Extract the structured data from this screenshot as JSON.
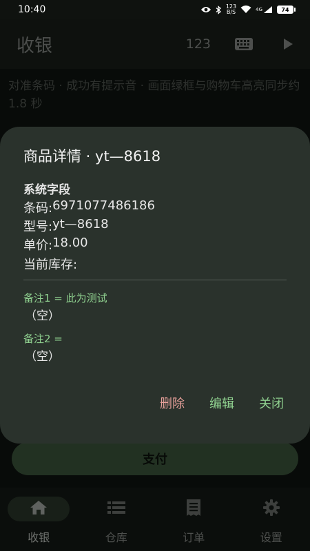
{
  "status_bar": {
    "time": "10:40",
    "speed_value": "123",
    "speed_unit": "B/S",
    "signal": "4G",
    "battery": "74"
  },
  "app_bar": {
    "title": "收银",
    "scan_count": "123"
  },
  "hint": "对准条码 · 成功有提示音 · 画面绿框与购物车高亮同步约 1.8 秒",
  "pay_button": {
    "label": "支付"
  },
  "dialog": {
    "title": "商品详情 · yt—8618",
    "section_title": "系统字段",
    "fields": [
      {
        "label": "条码:",
        "value": "6971077486186"
      },
      {
        "label": "型号:",
        "value": "yt—8618"
      },
      {
        "label": "单价:",
        "value": "18.00"
      },
      {
        "label": "当前库存:",
        "value": ""
      }
    ],
    "notes": [
      {
        "label": "备注1 = 此为测试",
        "value": "（空）"
      },
      {
        "label": "备注2 =",
        "value": "（空）"
      }
    ],
    "actions": {
      "delete": "删除",
      "edit": "编辑",
      "close": "关闭"
    }
  },
  "bottom_nav": {
    "items": [
      {
        "label": "收银",
        "icon": "home-icon",
        "active": true
      },
      {
        "label": "仓库",
        "icon": "list-icon",
        "active": false
      },
      {
        "label": "订单",
        "icon": "receipt-icon",
        "active": false
      },
      {
        "label": "设置",
        "icon": "gear-icon",
        "active": false
      }
    ]
  },
  "colors": {
    "accent_green": "#8fd08f",
    "delete_red": "#e9a19b",
    "pay_button_bg": "#3e5a3e",
    "dialog_bg": "#2a322c"
  }
}
